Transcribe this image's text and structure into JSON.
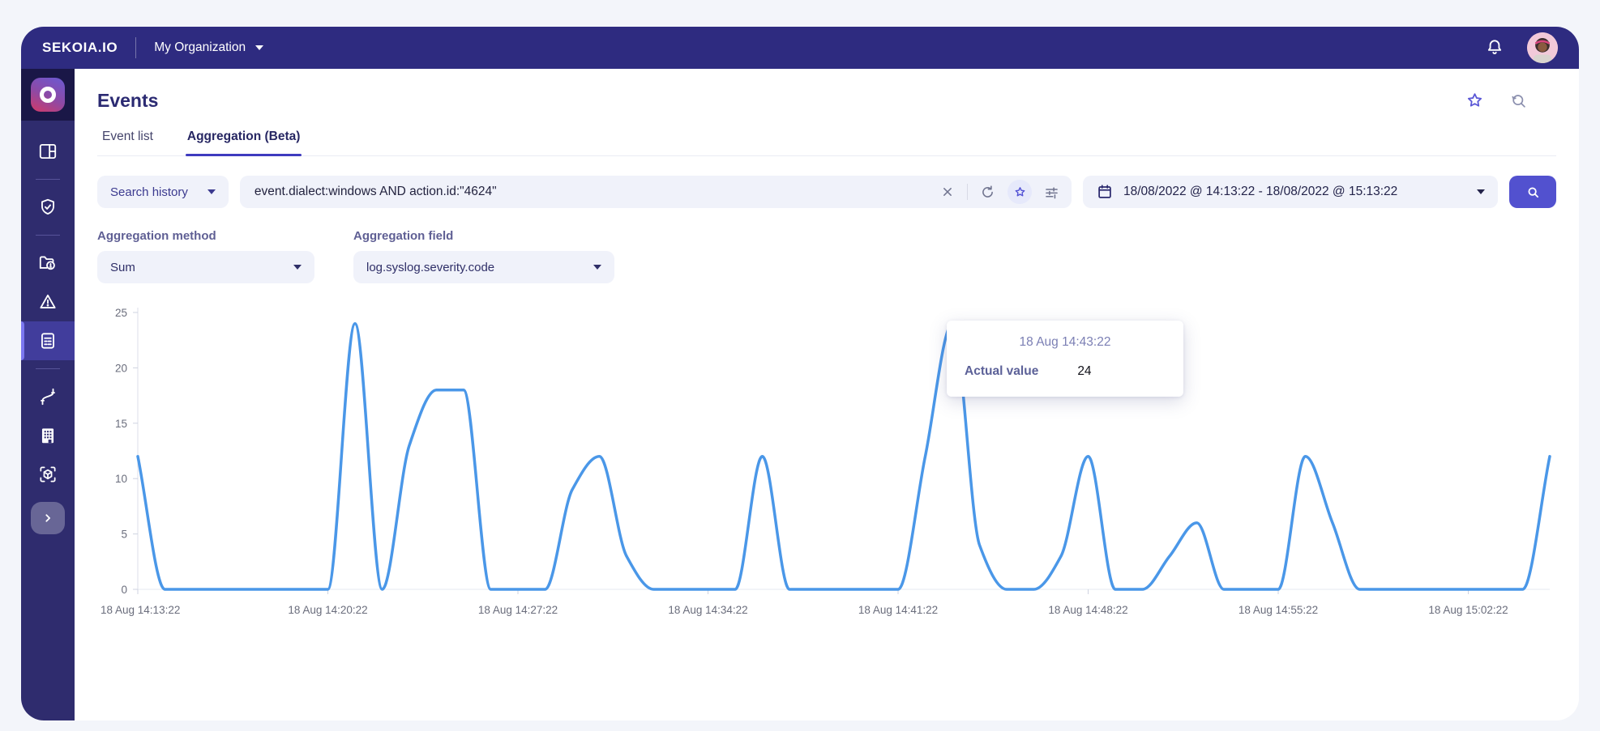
{
  "topbar": {
    "brand": "SEKOIA.IO",
    "org": "My Organization",
    "icons": [
      "chevron-down-icon",
      "bell-icon",
      "avatar"
    ]
  },
  "sidebar": {
    "icons": [
      "org-logo",
      "dashboard-icon",
      "shield-check-icon",
      "folder-alert-icon",
      "alert-triangle-icon",
      "events-list-icon",
      "intake-cable-icon",
      "building-icon",
      "cube-scan-icon",
      "expand-chevron-icon"
    ],
    "active_icon": "events-list-icon"
  },
  "header": {
    "title": "Events",
    "action_icons": [
      "favorite-star-icon",
      "search-history-icon"
    ]
  },
  "tabs": [
    {
      "label": "Event list",
      "active": false
    },
    {
      "label": "Aggregation (Beta)",
      "active": true
    }
  ],
  "search_bar": {
    "history_button": "Search history",
    "query": "event.dialect:windows AND action.id:\"4624\"",
    "field_icons": [
      "clear-icon",
      "refresh-icon",
      "favorite-star-icon",
      "filters-icon"
    ],
    "date_range": "18/08/2022 @ 14:13:22 - 18/08/2022 @ 15:13:22",
    "date_icon": "calendar-icon",
    "submit_icon": "search-icon"
  },
  "aggregation": {
    "method_label": "Aggregation method",
    "method_value": "Sum",
    "field_label": "Aggregation field",
    "field_value": "log.syslog.severity.code"
  },
  "tooltip": {
    "title": "18 Aug 14:43:22",
    "label": "Actual value",
    "value": "24"
  },
  "chart_data": {
    "type": "line",
    "title": "",
    "xlabel": "",
    "ylabel": "",
    "ylim": [
      0,
      25
    ],
    "y_ticks": [
      0,
      5,
      10,
      15,
      20,
      25
    ],
    "x_tick_labels": [
      "18 Aug 14:13:22",
      "18 Aug 14:20:22",
      "18 Aug 14:27:22",
      "18 Aug 14:34:22",
      "18 Aug 14:41:22",
      "18 Aug 14:48:22",
      "18 Aug 14:55:22",
      "18 Aug 15:02:22"
    ],
    "x_start": "18 Aug 14:13:22",
    "x_end": "18 Aug 15:05:22",
    "grid": false,
    "legend": "none",
    "series": [
      {
        "name": "Actual value",
        "color": "#4a97e8",
        "points": [
          [
            "14:13:22",
            12
          ],
          [
            "14:14:22",
            0
          ],
          [
            "14:15:22",
            0
          ],
          [
            "14:16:22",
            0
          ],
          [
            "14:17:22",
            0
          ],
          [
            "14:18:22",
            0
          ],
          [
            "14:19:22",
            0
          ],
          [
            "14:20:22",
            0
          ],
          [
            "14:21:22",
            24
          ],
          [
            "14:22:22",
            0
          ],
          [
            "14:23:22",
            13
          ],
          [
            "14:24:22",
            18
          ],
          [
            "14:25:22",
            18
          ],
          [
            "14:26:22",
            0
          ],
          [
            "14:27:22",
            0
          ],
          [
            "14:28:22",
            0
          ],
          [
            "14:29:22",
            9
          ],
          [
            "14:30:22",
            12
          ],
          [
            "14:31:22",
            3
          ],
          [
            "14:32:22",
            0
          ],
          [
            "14:33:22",
            0
          ],
          [
            "14:34:22",
            0
          ],
          [
            "14:35:22",
            0
          ],
          [
            "14:36:22",
            12
          ],
          [
            "14:37:22",
            0
          ],
          [
            "14:38:22",
            0
          ],
          [
            "14:39:22",
            0
          ],
          [
            "14:40:22",
            0
          ],
          [
            "14:41:22",
            0
          ],
          [
            "14:42:22",
            12
          ],
          [
            "14:43:22",
            24
          ],
          [
            "14:44:22",
            4
          ],
          [
            "14:45:22",
            0
          ],
          [
            "14:46:22",
            0
          ],
          [
            "14:47:22",
            3
          ],
          [
            "14:48:22",
            12
          ],
          [
            "14:49:22",
            0
          ],
          [
            "14:50:22",
            0
          ],
          [
            "14:51:22",
            3
          ],
          [
            "14:52:22",
            6
          ],
          [
            "14:53:22",
            0
          ],
          [
            "14:54:22",
            0
          ],
          [
            "14:55:22",
            0
          ],
          [
            "14:56:22",
            12
          ],
          [
            "14:57:22",
            6
          ],
          [
            "14:58:22",
            0
          ],
          [
            "14:59:22",
            0
          ],
          [
            "15:00:22",
            0
          ],
          [
            "15:01:22",
            0
          ],
          [
            "15:02:22",
            0
          ],
          [
            "15:03:22",
            0
          ],
          [
            "15:04:22",
            0
          ],
          [
            "15:05:22",
            12
          ]
        ]
      }
    ]
  },
  "colors": {
    "topbar_bg": "#2e2b80",
    "sidebar_bg": "#2f2c6e",
    "accent": "#5251cf",
    "line": "#4a97e8"
  }
}
